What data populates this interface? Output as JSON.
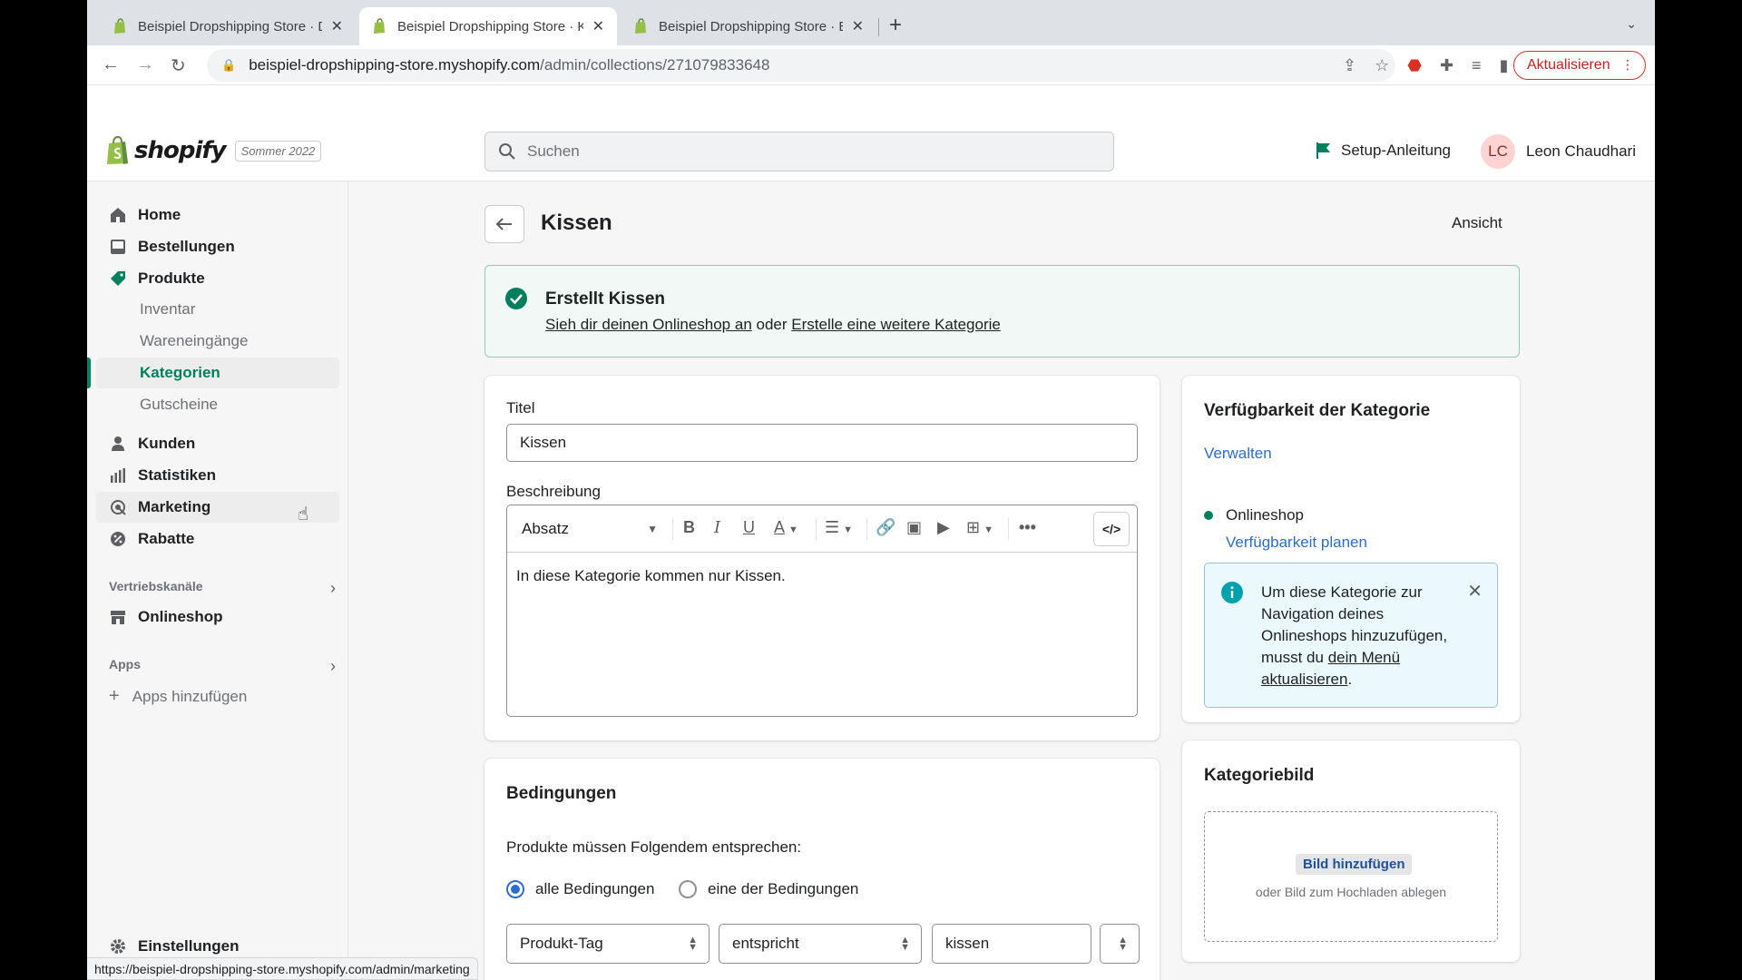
{
  "browser": {
    "tabs": [
      {
        "title": "Beispiel Dropshipping Store · D",
        "active": false
      },
      {
        "title": "Beispiel Dropshipping Store · K",
        "active": true
      },
      {
        "title": "Beispiel Dropshipping Store · B",
        "active": false
      }
    ],
    "url_host": "beispiel-dropshipping-store.myshopify.com",
    "url_path": "/admin/collections/271079833648",
    "update_label": "Aktualisieren",
    "status_url": "https://beispiel-dropshipping-store.myshopify.com/admin/marketing"
  },
  "header": {
    "brand": "shopify",
    "edition": "Sommer 2022",
    "search_placeholder": "Suchen",
    "setup_label": "Setup-Anleitung",
    "user_initials": "LC",
    "user_name": "Leon Chaudhari"
  },
  "sidebar": {
    "items": [
      {
        "label": "Home",
        "icon": "home-icon"
      },
      {
        "label": "Bestellungen",
        "icon": "orders-icon"
      },
      {
        "label": "Produkte",
        "icon": "tag-icon"
      }
    ],
    "product_sub": [
      "Inventar",
      "Wareneingänge",
      "Kategorien",
      "Gutscheine"
    ],
    "items2": [
      {
        "label": "Kunden",
        "icon": "person-icon"
      },
      {
        "label": "Statistiken",
        "icon": "analytics-icon"
      },
      {
        "label": "Marketing",
        "icon": "marketing-icon"
      },
      {
        "label": "Rabatte",
        "icon": "discount-icon"
      }
    ],
    "channels_label": "Vertriebskanäle",
    "onlineshop_label": "Onlineshop",
    "apps_label": "Apps",
    "add_apps_label": "Apps hinzufügen",
    "settings_label": "Einstellungen"
  },
  "page": {
    "title": "Kissen",
    "view_label": "Ansicht",
    "banner": {
      "title": "Erstellt Kissen",
      "link1": "Sieh dir deinen Onlineshop an",
      "middle": " oder ",
      "link2": "Erstelle eine weitere Kategorie"
    },
    "form": {
      "title_label": "Titel",
      "title_value": "Kissen",
      "description_label": "Beschreibung",
      "paragraph_format": "Absatz",
      "description_text": "In diese Kategorie kommen nur Kissen."
    },
    "conditions": {
      "heading": "Bedingungen",
      "match_label": "Produkte müssen Folgendem entsprechen:",
      "all_label": "alle Bedingungen",
      "any_label": "eine der Bedingungen",
      "field": "Produkt-Tag",
      "operator": "entspricht",
      "value": "kissen"
    },
    "availability": {
      "heading": "Verfügbarkeit der Kategorie",
      "manage_label": "Verwalten",
      "channel": "Onlineshop",
      "schedule_label": "Verfügbarkeit planen",
      "info_text_before": "Um diese Kategorie zur Navigation deines Onlineshops hinzuzufügen, musst du ",
      "info_link": "dein Menü aktualisieren",
      "info_text_after": "."
    },
    "image": {
      "heading": "Kategoriebild",
      "add_label": "Bild hinzufügen",
      "drop_text": "oder Bild zum Hochladen ablegen"
    }
  },
  "colors": {
    "accent_green": "#008060",
    "link_blue": "#2c6ecb",
    "banner_bg": "#f1f8f5",
    "info_bg": "#ebf9fc"
  }
}
